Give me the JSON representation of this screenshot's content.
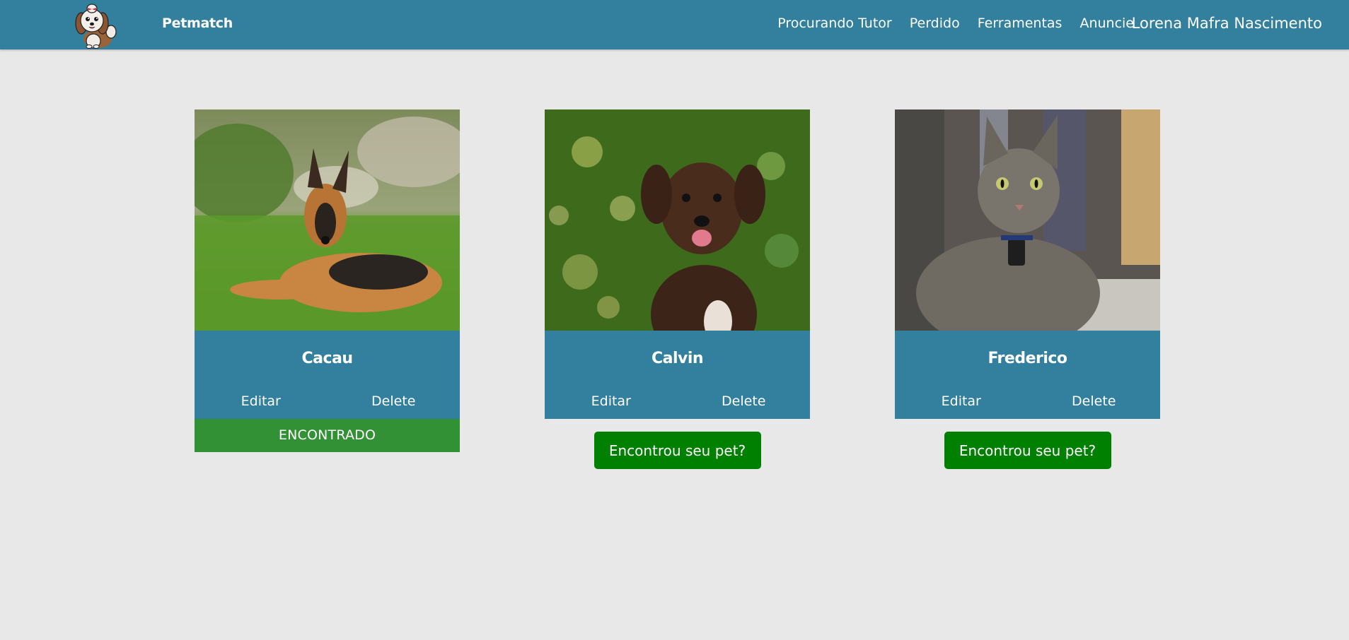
{
  "navbar": {
    "brand": "Petmatch",
    "links": [
      {
        "label": "Procurando Tutor"
      },
      {
        "label": "Perdido"
      },
      {
        "label": "Ferramentas"
      },
      {
        "label": "Anuncie"
      }
    ],
    "user_name": "Lorena Mafra Nascimento",
    "logo_icon": "shih-tzu-dog-logo"
  },
  "pets": [
    {
      "name": "Cacau",
      "photo": "german-shepherd-on-grass",
      "edit_label": "Editar",
      "delete_label": "Delete",
      "status_label": "ENCONTRADO"
    },
    {
      "name": "Calvin",
      "photo": "brown-puppy-bokeh",
      "edit_label": "Editar",
      "delete_label": "Delete",
      "found_button_label": "Encontrou seu pet?"
    },
    {
      "name": "Frederico",
      "photo": "tabby-cat",
      "edit_label": "Editar",
      "delete_label": "Delete",
      "found_button_label": "Encontrou seu pet?"
    }
  ],
  "colors": {
    "background": "#e8e8e8",
    "primary": "#337f9e",
    "found_banner": "#339135",
    "found_button": "#008000",
    "text_on_primary": "#ffffff"
  }
}
